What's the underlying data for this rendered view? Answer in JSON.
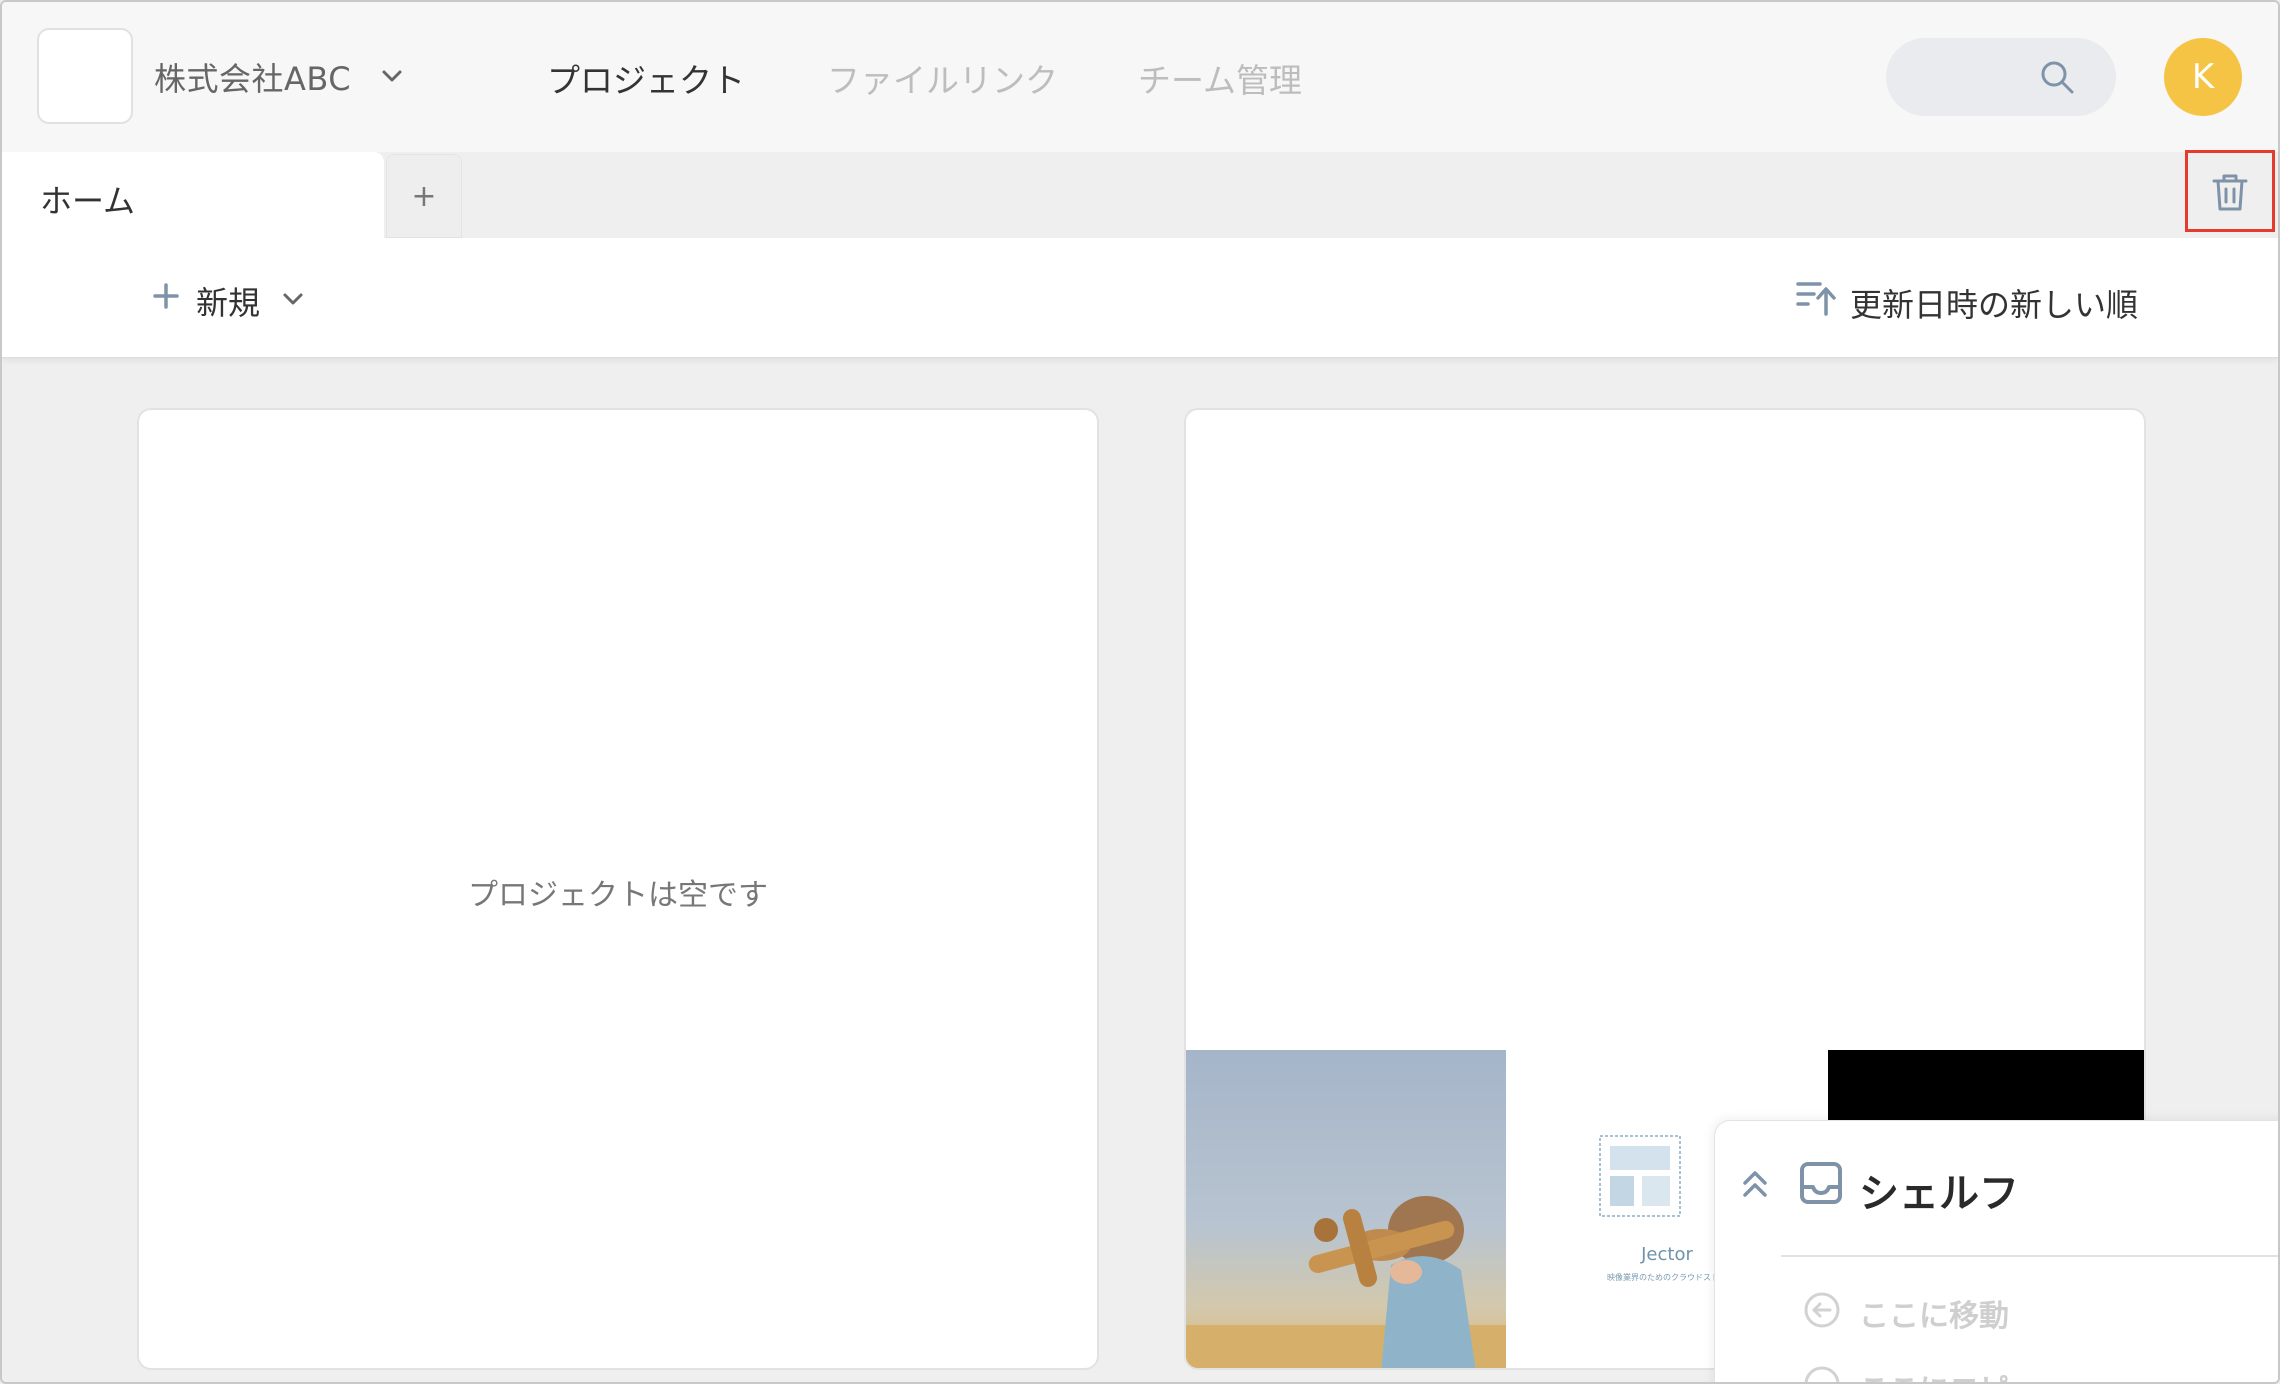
{
  "header": {
    "org_name": "株式会社ABC",
    "nav": [
      {
        "label": "プロジェクト",
        "active": true
      },
      {
        "label": "ファイルリンク",
        "active": false
      },
      {
        "label": "チーム管理",
        "active": false
      }
    ],
    "avatar_initial": "K",
    "avatar_color": "#f5c444"
  },
  "tabs": {
    "home_label": "ホーム",
    "add_label": "+"
  },
  "toolbar": {
    "new_label": "新規",
    "sort_label": "更新日時の新しい順"
  },
  "projects": {
    "empty_text": "プロジェクトは空です",
    "thumb_logo_title": "Jector",
    "thumb_logo_subtitle": "映像業界のためのクラウドストレ"
  },
  "shelf": {
    "title": "シェルフ",
    "move_here": "ここに移動",
    "copy_here": "ここにコピ"
  },
  "colors": {
    "accent_red": "#e53b2c",
    "icon_slate": "#7f93a8"
  },
  "icons": [
    "chevron-down-icon",
    "search-icon",
    "trash-icon",
    "plus-icon",
    "sort-icon",
    "double-chevron-up-icon",
    "inbox-tray-icon",
    "arrow-left-circle-icon"
  ]
}
